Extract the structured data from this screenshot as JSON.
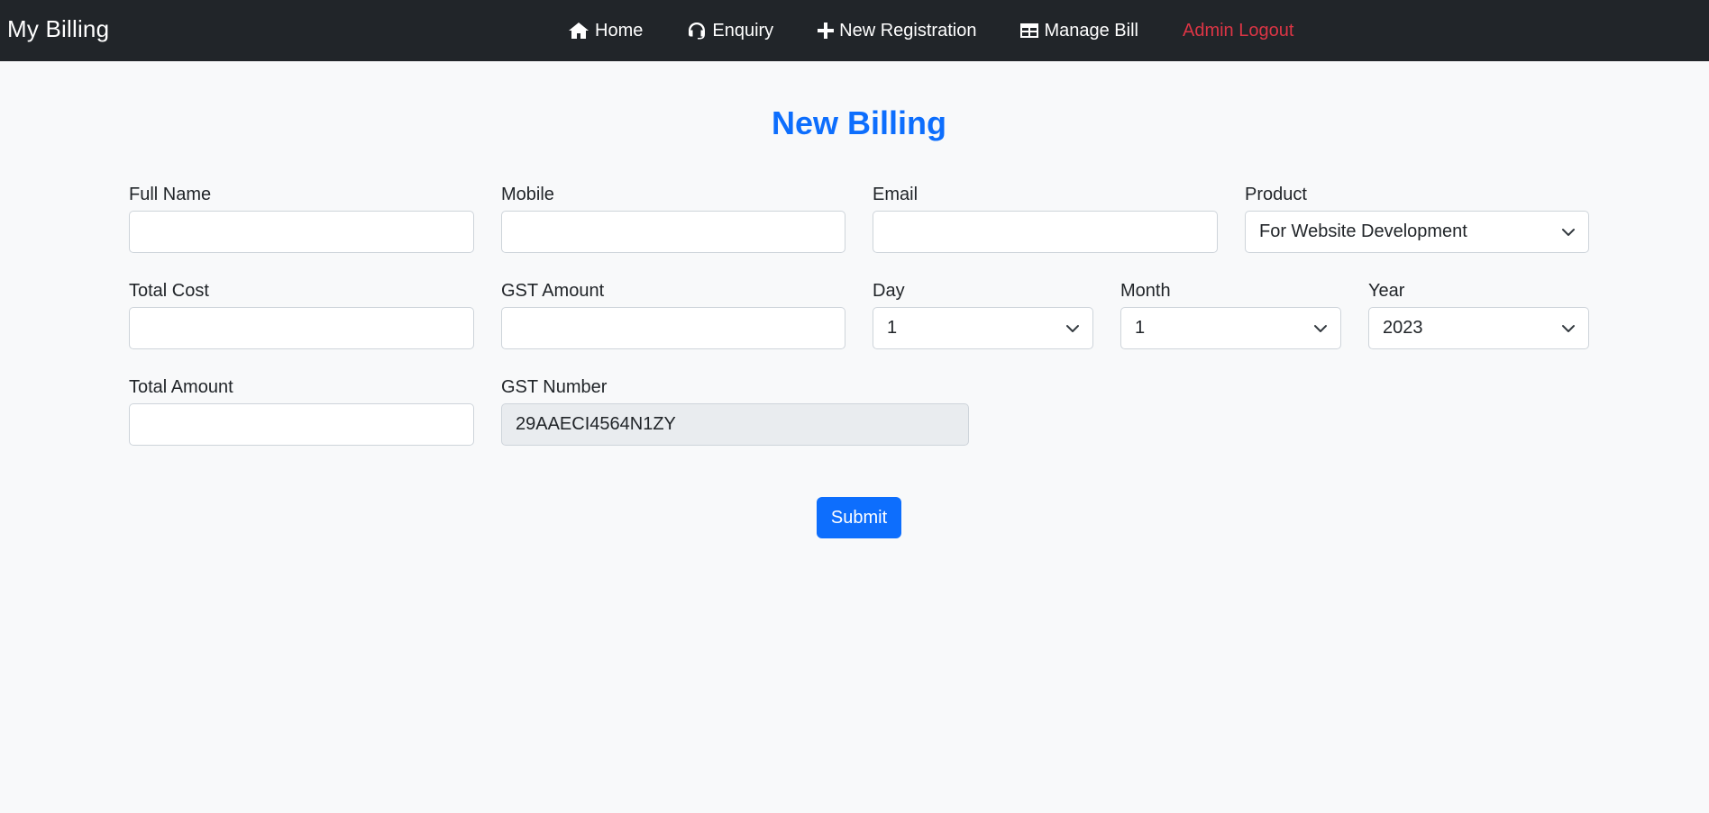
{
  "app": {
    "brand": "My Billing"
  },
  "nav": {
    "home": "Home",
    "enquiry": "Enquiry",
    "new_registration": "New Registration",
    "manage_bill": "Manage Bill",
    "logout": "Admin Logout"
  },
  "form": {
    "title": "New Billing",
    "full_name": {
      "label": "Full Name",
      "value": ""
    },
    "mobile": {
      "label": "Mobile",
      "value": ""
    },
    "email": {
      "label": "Email",
      "value": ""
    },
    "product": {
      "label": "Product",
      "value": "For Website Development"
    },
    "total_cost": {
      "label": "Total Cost",
      "value": ""
    },
    "gst_amount": {
      "label": "GST Amount",
      "value": ""
    },
    "day": {
      "label": "Day",
      "value": "1"
    },
    "month": {
      "label": "Month",
      "value": "1"
    },
    "year": {
      "label": "Year",
      "value": "2023"
    },
    "total_amount": {
      "label": "Total Amount",
      "value": ""
    },
    "gst_number": {
      "label": "GST Number",
      "value": "29AAECI4564N1ZY"
    },
    "submit": "Submit"
  },
  "colors": {
    "navbar": "#212529",
    "primary": "#0d6efd",
    "danger": "#dc3545",
    "background": "#f8f9fa"
  }
}
